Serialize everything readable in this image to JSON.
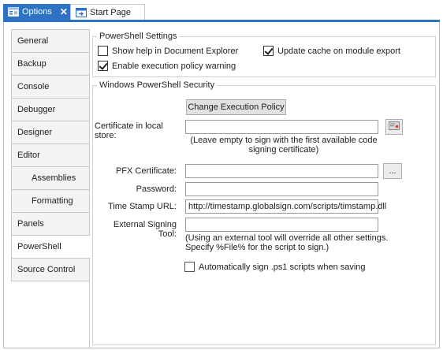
{
  "tabs": {
    "options": {
      "label": "Options",
      "icon": "options-window-icon"
    },
    "start_page": {
      "label": "Start Page",
      "icon": "start-page-icon"
    }
  },
  "nav": {
    "items": [
      {
        "label": "General"
      },
      {
        "label": "Backup"
      },
      {
        "label": "Console"
      },
      {
        "label": "Debugger"
      },
      {
        "label": "Designer"
      },
      {
        "label": "Editor"
      },
      {
        "label": "Assemblies"
      },
      {
        "label": "Formatting"
      },
      {
        "label": "Panels"
      },
      {
        "label": "PowerShell"
      },
      {
        "label": "Source Control"
      }
    ],
    "selected": "PowerShell"
  },
  "powershell_settings": {
    "title": "PowerShell Settings",
    "show_help_label": "Show help in Document Explorer",
    "show_help_checked": false,
    "update_cache_label": "Update cache on module export",
    "update_cache_checked": true,
    "exec_policy_warning_label": "Enable execution policy warning",
    "exec_policy_warning_checked": true
  },
  "security": {
    "title": "Windows PowerShell Security",
    "change_policy_button": "Change Execution Policy",
    "certificate_label": "Certificate in local store:",
    "certificate_value": "",
    "certificate_note": "(Leave empty to sign with the first available code signing certificate)",
    "pfx_label": "PFX Certificate:",
    "pfx_value": "",
    "browse_button": "...",
    "password_label": "Password:",
    "password_value": "",
    "timestamp_label": "Time Stamp URL:",
    "timestamp_value": "http://timestamp.globalsign.com/scripts/timstamp.dll",
    "external_tool_label": "External Signing Tool:",
    "external_tool_value": "",
    "external_tool_note_line1": "(Using an external tool will override all other settings.",
    "external_tool_note_line2": "Specify %File% for the script to sign.)",
    "auto_sign_label": "Automatically sign .ps1 scripts when saving",
    "auto_sign_checked": false
  },
  "colors": {
    "accent": "#2f72c4"
  }
}
